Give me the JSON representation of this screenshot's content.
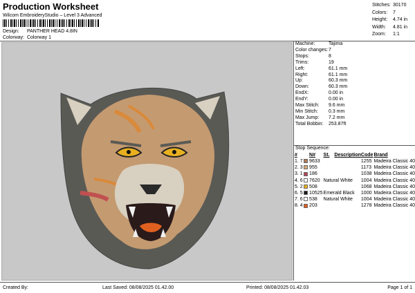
{
  "header": {
    "title": "Production Worksheet",
    "subtitle": "Wilcom EmbroideryStudio – Level 3 Advanced",
    "design_label": "Design:",
    "design_value": "PANTHER HEAD 4.8IN",
    "colorway_label": "Colorway:",
    "colorway_value": "Colorway 1"
  },
  "stats": [
    {
      "label": "Stitches:",
      "value": "30170"
    },
    {
      "label": "Colors:",
      "value": "7"
    },
    {
      "label": "Height:",
      "value": "4.74 in"
    },
    {
      "label": "Width:",
      "value": "4.81 in"
    },
    {
      "label": "Zoom:",
      "value": "1:1"
    }
  ],
  "machine": [
    {
      "label": "Machine:",
      "value": "Tajima"
    },
    {
      "label": "Color changes:",
      "value": "7"
    },
    {
      "label": "Stops:",
      "value": "8"
    },
    {
      "label": "Trims:",
      "value": "19"
    },
    {
      "label": "Left:",
      "value": "61.1 mm"
    },
    {
      "label": "Right:",
      "value": "61.1 mm"
    },
    {
      "label": "Up:",
      "value": "60.3 mm"
    },
    {
      "label": "Down:",
      "value": "60.3 mm"
    },
    {
      "label": "EndX:",
      "value": "0.00 in"
    },
    {
      "label": "EndY:",
      "value": "0.00 in"
    },
    {
      "label": "Max Stitch:",
      "value": "9.6 mm"
    },
    {
      "label": "Min Stitch:",
      "value": "0.3 mm"
    },
    {
      "label": "Max Jump:",
      "value": "7.2 mm"
    },
    {
      "label": "Total Bobbin:",
      "value": "253.87ft"
    }
  ],
  "stop_sequence": {
    "title": "Stop Sequence:",
    "headers": {
      "num": "#",
      "n": "N#",
      "st": "St.",
      "description": "Description",
      "code": "Code",
      "brand": "Brand"
    },
    "rows": [
      {
        "num": "1.",
        "stop": "7",
        "color": "#b07a5a",
        "n": "9633",
        "desc": "",
        "st": "1255",
        "brand": "Madeira Classic 40"
      },
      {
        "num": "2.",
        "stop": "3",
        "color": "#d9a87a",
        "n": "955",
        "desc": "",
        "st": "1173",
        "brand": "Madeira Classic 40"
      },
      {
        "num": "3.",
        "stop": "1",
        "color": "#b0485a",
        "n": "186",
        "desc": "",
        "st": "1038",
        "brand": "Madeira Classic 40"
      },
      {
        "num": "4.",
        "stop": "6",
        "color": "#ffffff",
        "n": "7620",
        "desc": "Natural White",
        "st": "1004",
        "brand": "Madeira Classic 40"
      },
      {
        "num": "5.",
        "stop": "2",
        "color": "#e8b020",
        "n": "508",
        "desc": "",
        "st": "1068",
        "brand": "Madeira Classic 40"
      },
      {
        "num": "6.",
        "stop": "5",
        "color": "#1a1a1a",
        "n": "10525",
        "desc": "Emerald Black",
        "st": "1000",
        "brand": "Madeira Classic 40"
      },
      {
        "num": "7.",
        "stop": "6",
        "color": "#ffffff",
        "n": "538",
        "desc": "Natural White",
        "st": "1004",
        "brand": "Madeira Classic 40"
      },
      {
        "num": "8.",
        "stop": "4",
        "color": "#e06020",
        "n": "203",
        "desc": "",
        "st": "1278",
        "brand": "Madeira Classic 40"
      }
    ]
  },
  "footer": {
    "created_by": "Created By:",
    "last_saved": "Last Saved: 08/08/2025 01.42.00",
    "printed": "Printed: 08/08/2025 01.42.03",
    "page": "Page 1 of 1"
  },
  "colors": {
    "outline": "#5a5a55",
    "fur": "#c49a70",
    "light_fur": "#d8d0c0",
    "eye": "#e8b020",
    "mouth": "#2a1a1a",
    "tongue": "#e06020",
    "stripe": "#c05050",
    "ear": "#d98a3a"
  }
}
